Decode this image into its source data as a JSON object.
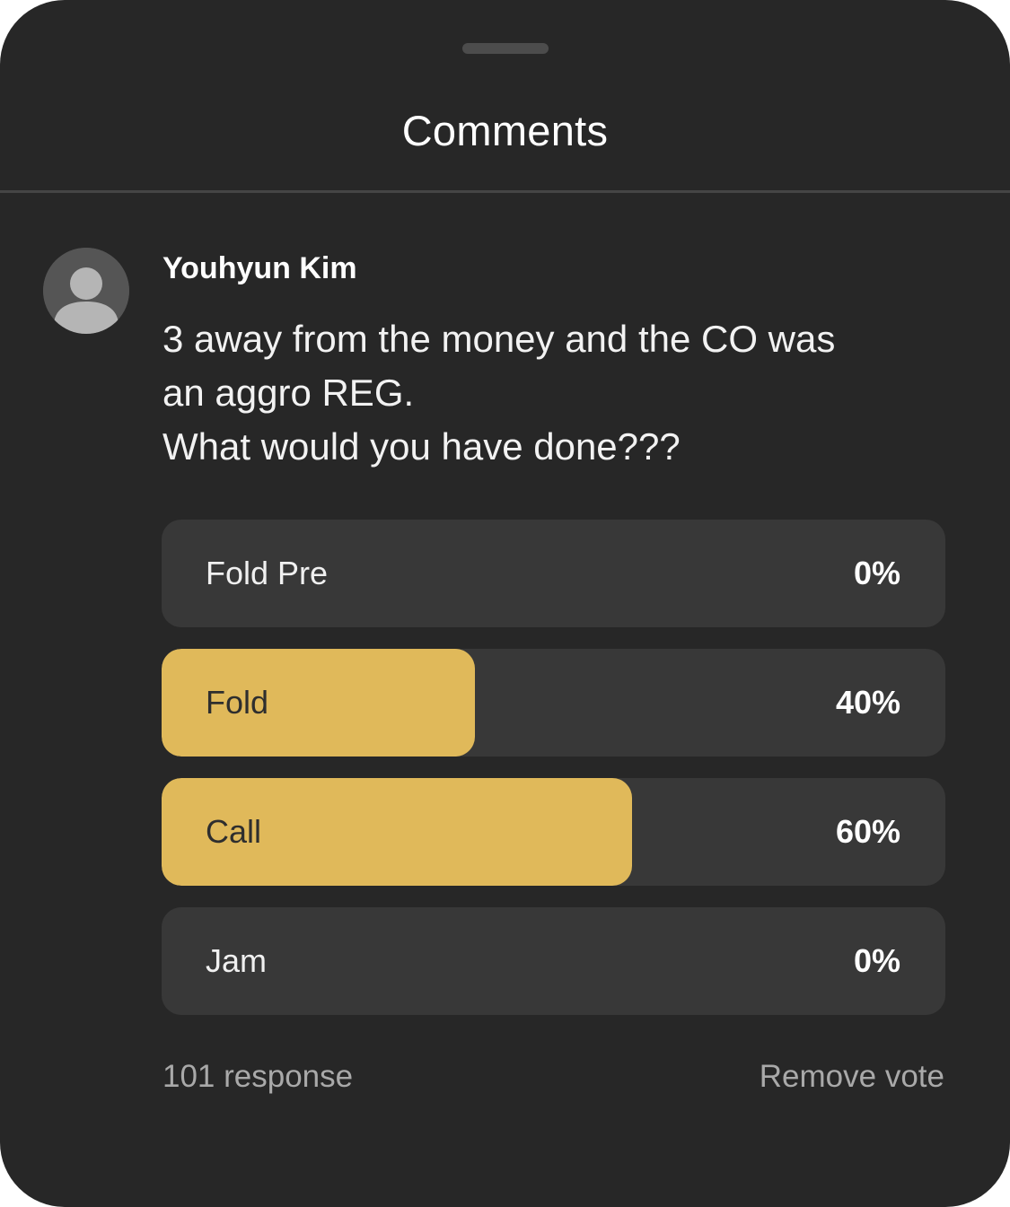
{
  "sheet": {
    "title": "Comments"
  },
  "comment": {
    "author": "Youhyun Kim",
    "avatar_icon": "user-silhouette-icon",
    "lines": [
      "3 away from the money and the CO was",
      "an aggro REG.",
      "What would you have done???"
    ]
  },
  "poll": {
    "options": [
      {
        "label": "Fold Pre",
        "percent_text": "0%",
        "percent": 0
      },
      {
        "label": "Fold",
        "percent_text": "40%",
        "percent": 40
      },
      {
        "label": "Call",
        "percent_text": "60%",
        "percent": 60
      },
      {
        "label": "Jam",
        "percent_text": "0%",
        "percent": 0
      }
    ],
    "responses_text": "101 response",
    "remove_vote_label": "Remove vote"
  },
  "colors": {
    "background": "#272727",
    "option_track": "#383838",
    "accent_fill": "#e0b95a",
    "muted_text": "#a9a9a9"
  }
}
